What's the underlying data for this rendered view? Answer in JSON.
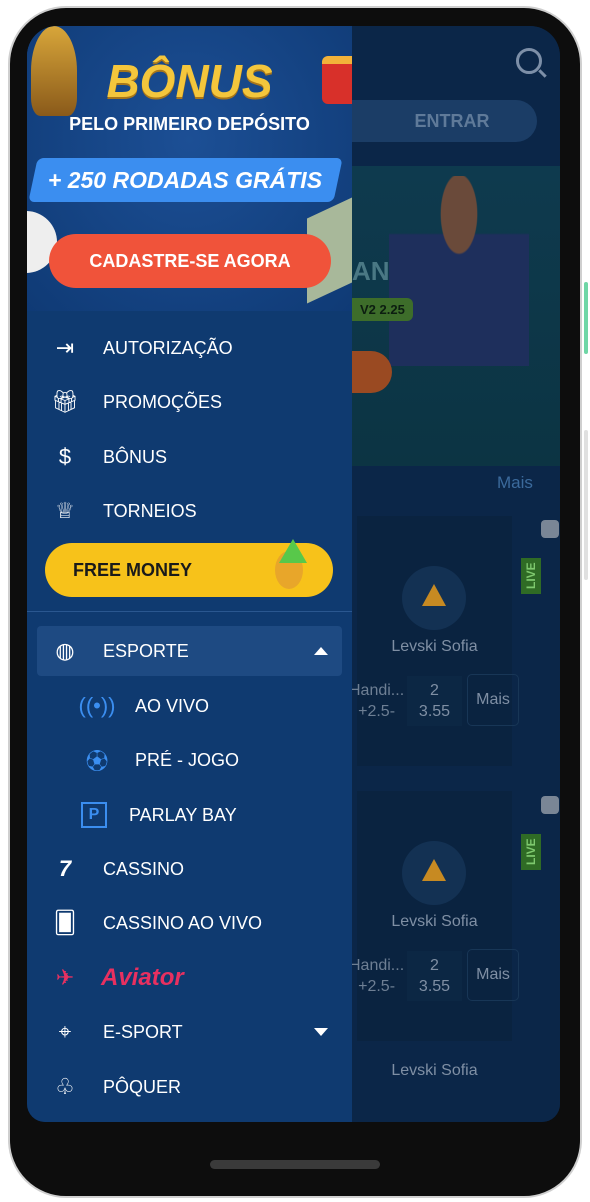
{
  "background": {
    "entrar": "ENTRAR",
    "hero_text": "AN",
    "hero_odd": "V2 2.25",
    "mais_top": "Mais",
    "cards": [
      {
        "team": "Levski Sofia",
        "handicap": "Handi...",
        "handicap_value": "+2.5-",
        "odd_label": "2",
        "odd_value": "3.55",
        "more": "Mais",
        "live": "LIVE"
      },
      {
        "team": "Levski Sofia",
        "handicap": "Handi...",
        "handicap_value": "+2.5-",
        "odd_label": "2",
        "odd_value": "3.55",
        "more": "Mais",
        "live": "LIVE"
      }
    ],
    "team_bottom": "Levski Sofia"
  },
  "banner": {
    "title": "BÔNUS",
    "subtitle": "PELO PRIMEIRO DEPÓSITO",
    "spins": "+ 250 RODADAS GRÁTIS",
    "cta": "CADASTRE-SE AGORA"
  },
  "menu": {
    "autorizacao": "AUTORIZAÇÃO",
    "promocoes": "PROMOÇÕES",
    "bonus": "BÔNUS",
    "torneios": "TORNEIOS",
    "free_money": "FREE MONEY",
    "esporte": "ESPORTE",
    "ao_vivo": "AO VIVO",
    "pre_jogo": "PRÉ - JOGO",
    "parlay": "PARLAY BAY",
    "cassino": "CASSINO",
    "cassino_ao_vivo": "CASSINO AO VIVO",
    "aviator": "Aviator",
    "esport": "E-SPORT",
    "poquer": "PÔQUER"
  },
  "colors": {
    "drawer": "#0f3a70",
    "accent": "#3b8ef0",
    "cta": "#f0533a",
    "free_money": "#f7c21a",
    "aviator": "#e83060"
  }
}
